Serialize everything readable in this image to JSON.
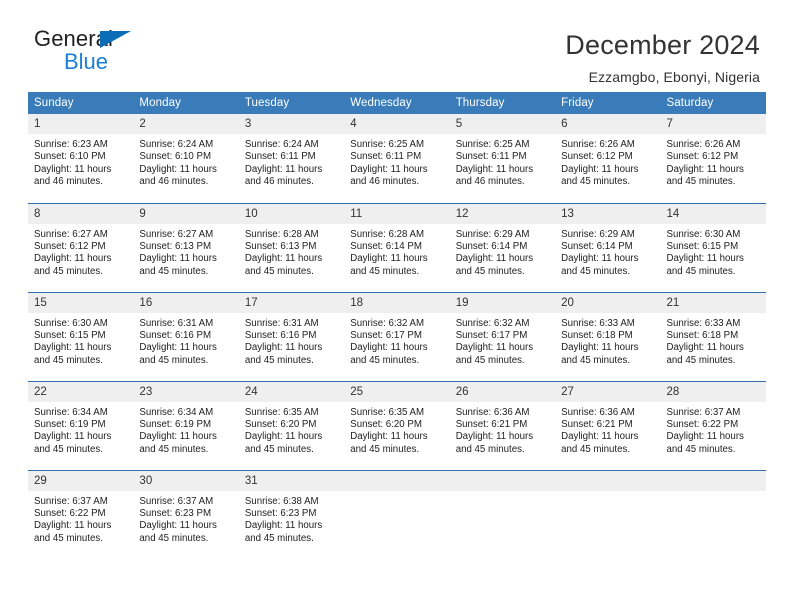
{
  "brand": {
    "name_part1": "General",
    "name_part2": "Blue",
    "triangle_icon": "triangle-icon",
    "accent_color": "#1b7fd4",
    "dark_color": "#231f20"
  },
  "header": {
    "title": "December 2024",
    "subtitle": "Ezzamgbo, Ebonyi, Nigeria"
  },
  "calendar": {
    "header_bg": "#3a7cb9",
    "row_border_color": "#2f6fb0",
    "daynum_bg": "#efefef",
    "weekdays": [
      "Sunday",
      "Monday",
      "Tuesday",
      "Wednesday",
      "Thursday",
      "Friday",
      "Saturday"
    ],
    "weeks": [
      [
        {
          "day": "1",
          "sunrise": "Sunrise: 6:23 AM",
          "sunset": "Sunset: 6:10 PM",
          "daylight1": "Daylight: 11 hours",
          "daylight2": "and 46 minutes."
        },
        {
          "day": "2",
          "sunrise": "Sunrise: 6:24 AM",
          "sunset": "Sunset: 6:10 PM",
          "daylight1": "Daylight: 11 hours",
          "daylight2": "and 46 minutes."
        },
        {
          "day": "3",
          "sunrise": "Sunrise: 6:24 AM",
          "sunset": "Sunset: 6:11 PM",
          "daylight1": "Daylight: 11 hours",
          "daylight2": "and 46 minutes."
        },
        {
          "day": "4",
          "sunrise": "Sunrise: 6:25 AM",
          "sunset": "Sunset: 6:11 PM",
          "daylight1": "Daylight: 11 hours",
          "daylight2": "and 46 minutes."
        },
        {
          "day": "5",
          "sunrise": "Sunrise: 6:25 AM",
          "sunset": "Sunset: 6:11 PM",
          "daylight1": "Daylight: 11 hours",
          "daylight2": "and 46 minutes."
        },
        {
          "day": "6",
          "sunrise": "Sunrise: 6:26 AM",
          "sunset": "Sunset: 6:12 PM",
          "daylight1": "Daylight: 11 hours",
          "daylight2": "and 45 minutes."
        },
        {
          "day": "7",
          "sunrise": "Sunrise: 6:26 AM",
          "sunset": "Sunset: 6:12 PM",
          "daylight1": "Daylight: 11 hours",
          "daylight2": "and 45 minutes."
        }
      ],
      [
        {
          "day": "8",
          "sunrise": "Sunrise: 6:27 AM",
          "sunset": "Sunset: 6:12 PM",
          "daylight1": "Daylight: 11 hours",
          "daylight2": "and 45 minutes."
        },
        {
          "day": "9",
          "sunrise": "Sunrise: 6:27 AM",
          "sunset": "Sunset: 6:13 PM",
          "daylight1": "Daylight: 11 hours",
          "daylight2": "and 45 minutes."
        },
        {
          "day": "10",
          "sunrise": "Sunrise: 6:28 AM",
          "sunset": "Sunset: 6:13 PM",
          "daylight1": "Daylight: 11 hours",
          "daylight2": "and 45 minutes."
        },
        {
          "day": "11",
          "sunrise": "Sunrise: 6:28 AM",
          "sunset": "Sunset: 6:14 PM",
          "daylight1": "Daylight: 11 hours",
          "daylight2": "and 45 minutes."
        },
        {
          "day": "12",
          "sunrise": "Sunrise: 6:29 AM",
          "sunset": "Sunset: 6:14 PM",
          "daylight1": "Daylight: 11 hours",
          "daylight2": "and 45 minutes."
        },
        {
          "day": "13",
          "sunrise": "Sunrise: 6:29 AM",
          "sunset": "Sunset: 6:14 PM",
          "daylight1": "Daylight: 11 hours",
          "daylight2": "and 45 minutes."
        },
        {
          "day": "14",
          "sunrise": "Sunrise: 6:30 AM",
          "sunset": "Sunset: 6:15 PM",
          "daylight1": "Daylight: 11 hours",
          "daylight2": "and 45 minutes."
        }
      ],
      [
        {
          "day": "15",
          "sunrise": "Sunrise: 6:30 AM",
          "sunset": "Sunset: 6:15 PM",
          "daylight1": "Daylight: 11 hours",
          "daylight2": "and 45 minutes."
        },
        {
          "day": "16",
          "sunrise": "Sunrise: 6:31 AM",
          "sunset": "Sunset: 6:16 PM",
          "daylight1": "Daylight: 11 hours",
          "daylight2": "and 45 minutes."
        },
        {
          "day": "17",
          "sunrise": "Sunrise: 6:31 AM",
          "sunset": "Sunset: 6:16 PM",
          "daylight1": "Daylight: 11 hours",
          "daylight2": "and 45 minutes."
        },
        {
          "day": "18",
          "sunrise": "Sunrise: 6:32 AM",
          "sunset": "Sunset: 6:17 PM",
          "daylight1": "Daylight: 11 hours",
          "daylight2": "and 45 minutes."
        },
        {
          "day": "19",
          "sunrise": "Sunrise: 6:32 AM",
          "sunset": "Sunset: 6:17 PM",
          "daylight1": "Daylight: 11 hours",
          "daylight2": "and 45 minutes."
        },
        {
          "day": "20",
          "sunrise": "Sunrise: 6:33 AM",
          "sunset": "Sunset: 6:18 PM",
          "daylight1": "Daylight: 11 hours",
          "daylight2": "and 45 minutes."
        },
        {
          "day": "21",
          "sunrise": "Sunrise: 6:33 AM",
          "sunset": "Sunset: 6:18 PM",
          "daylight1": "Daylight: 11 hours",
          "daylight2": "and 45 minutes."
        }
      ],
      [
        {
          "day": "22",
          "sunrise": "Sunrise: 6:34 AM",
          "sunset": "Sunset: 6:19 PM",
          "daylight1": "Daylight: 11 hours",
          "daylight2": "and 45 minutes."
        },
        {
          "day": "23",
          "sunrise": "Sunrise: 6:34 AM",
          "sunset": "Sunset: 6:19 PM",
          "daylight1": "Daylight: 11 hours",
          "daylight2": "and 45 minutes."
        },
        {
          "day": "24",
          "sunrise": "Sunrise: 6:35 AM",
          "sunset": "Sunset: 6:20 PM",
          "daylight1": "Daylight: 11 hours",
          "daylight2": "and 45 minutes."
        },
        {
          "day": "25",
          "sunrise": "Sunrise: 6:35 AM",
          "sunset": "Sunset: 6:20 PM",
          "daylight1": "Daylight: 11 hours",
          "daylight2": "and 45 minutes."
        },
        {
          "day": "26",
          "sunrise": "Sunrise: 6:36 AM",
          "sunset": "Sunset: 6:21 PM",
          "daylight1": "Daylight: 11 hours",
          "daylight2": "and 45 minutes."
        },
        {
          "day": "27",
          "sunrise": "Sunrise: 6:36 AM",
          "sunset": "Sunset: 6:21 PM",
          "daylight1": "Daylight: 11 hours",
          "daylight2": "and 45 minutes."
        },
        {
          "day": "28",
          "sunrise": "Sunrise: 6:37 AM",
          "sunset": "Sunset: 6:22 PM",
          "daylight1": "Daylight: 11 hours",
          "daylight2": "and 45 minutes."
        }
      ],
      [
        {
          "day": "29",
          "sunrise": "Sunrise: 6:37 AM",
          "sunset": "Sunset: 6:22 PM",
          "daylight1": "Daylight: 11 hours",
          "daylight2": "and 45 minutes."
        },
        {
          "day": "30",
          "sunrise": "Sunrise: 6:37 AM",
          "sunset": "Sunset: 6:23 PM",
          "daylight1": "Daylight: 11 hours",
          "daylight2": "and 45 minutes."
        },
        {
          "day": "31",
          "sunrise": "Sunrise: 6:38 AM",
          "sunset": "Sunset: 6:23 PM",
          "daylight1": "Daylight: 11 hours",
          "daylight2": "and 45 minutes."
        },
        {
          "day": "",
          "sunrise": "",
          "sunset": "",
          "daylight1": "",
          "daylight2": ""
        },
        {
          "day": "",
          "sunrise": "",
          "sunset": "",
          "daylight1": "",
          "daylight2": ""
        },
        {
          "day": "",
          "sunrise": "",
          "sunset": "",
          "daylight1": "",
          "daylight2": ""
        },
        {
          "day": "",
          "sunrise": "",
          "sunset": "",
          "daylight1": "",
          "daylight2": ""
        }
      ]
    ]
  }
}
